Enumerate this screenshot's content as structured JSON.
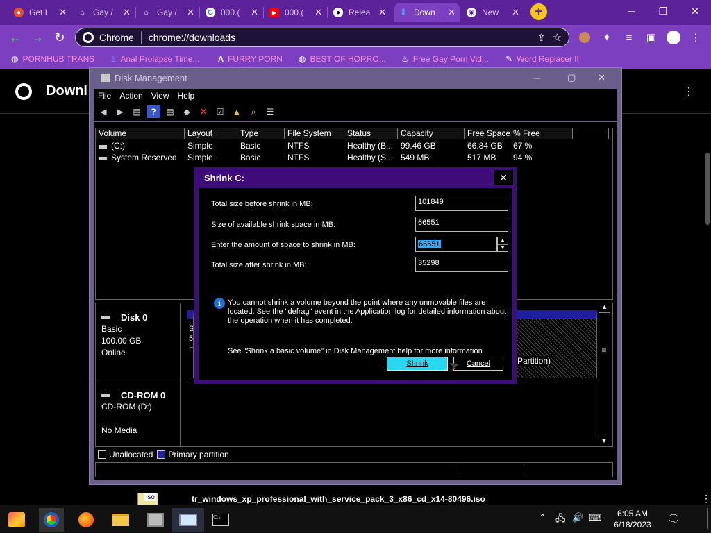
{
  "browser": {
    "tabs": [
      {
        "title": "Get I",
        "icon": "circle-brand-icon",
        "color": "#e8502c"
      },
      {
        "title": "Gay /",
        "icon": "museum-icon",
        "color": "#ffffff"
      },
      {
        "title": "Gay /",
        "icon": "museum-icon",
        "color": "#ffffff"
      },
      {
        "title": "000.(",
        "icon": "google-icon",
        "color": "#4285f4"
      },
      {
        "title": "000.(",
        "icon": "youtube-icon",
        "color": "#ff0000"
      },
      {
        "title": "Relea",
        "icon": "github-icon",
        "color": "#ffffff"
      },
      {
        "title": "Down",
        "icon": "download-icon",
        "color": "#4fa3ff",
        "active": true
      },
      {
        "title": "New",
        "icon": "chrome-icon",
        "color": "#ffffff"
      }
    ],
    "new_tab": "+",
    "omnibox": {
      "site": "Chrome",
      "url": "chrome://downloads"
    },
    "bookmarks": [
      "PORNHUB TRANS",
      "Anal Prolapse Time...",
      "FURRY PORN",
      "BEST OF HORRO...",
      "Free Gay Porn Vid...",
      "Word Replacer II"
    ],
    "page_title": "Downl"
  },
  "disk_management": {
    "title": "Disk Management",
    "menu": [
      "File",
      "Action",
      "View",
      "Help"
    ],
    "columns": [
      "Volume",
      "Layout",
      "Type",
      "File System",
      "Status",
      "Capacity",
      "Free Space",
      "% Free"
    ],
    "volumes": [
      [
        "(C:)",
        "Simple",
        "Basic",
        "NTFS",
        "Healthy (B...",
        "99.46 GB",
        "66.84 GB",
        "67 %"
      ],
      [
        "System Reserved",
        "Simple",
        "Basic",
        "NTFS",
        "Healthy (S...",
        "549 MB",
        "517 MB",
        "94 %"
      ]
    ],
    "disks": [
      {
        "name": "Disk 0",
        "lines": [
          "Basic",
          "100.00 GB",
          "Online"
        ]
      },
      {
        "name": "CD-ROM 0",
        "lines": [
          "CD-ROM (D:)",
          "",
          "No Media"
        ]
      }
    ],
    "partition_fragments": [
      "S",
      "5",
      "H"
    ],
    "partition_label": "Partition)",
    "legend": [
      "Unallocated",
      "Primary partition"
    ]
  },
  "dialog": {
    "title": "Shrink C:",
    "fields": [
      {
        "label": "Total size before shrink in MB:",
        "value": "101849"
      },
      {
        "label": "Size of available shrink space in MB:",
        "value": "66551"
      },
      {
        "label": "Enter the amount of space to shrink in MB:",
        "value": "66551"
      },
      {
        "label": "Total size after shrink in MB:",
        "value": "35298"
      }
    ],
    "info": "You cannot shrink a volume beyond the point where any unmovable files are located. See the \"defrag\" event in the Application log for detailed information about the operation when it has completed.",
    "help": "See \"Shrink a basic volume\" in Disk Management help for more information",
    "shrink_button": "Shrink",
    "cancel_button": "Cancel"
  },
  "download_bar": {
    "filename": "tr_windows_xp_professional_with_service_pack_3_x86_cd_x14-80496.iso",
    "file_icon_label": "iso"
  },
  "taskbar": {
    "time": "6:05 AM",
    "date": "6/18/2023"
  }
}
